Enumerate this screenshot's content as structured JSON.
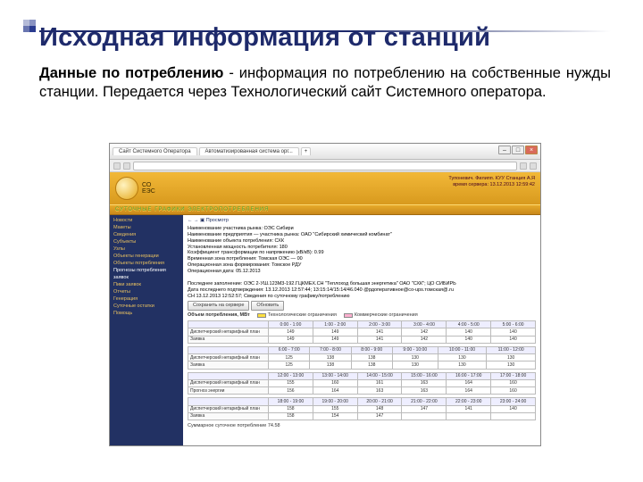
{
  "title": "Исходная информация от станций",
  "desc_bold": "Данные по потреблению",
  "desc_rest": " - информация по потреблению на собственные нужды станции. Передается через Технологический сайт Системного оператора.",
  "browser": {
    "tab1": "Сайт Системного Оператора",
    "tab2": "Автоматизированная система орг...",
    "plus": "+"
  },
  "banner": {
    "org1": "СО",
    "org2": "ЕЭС",
    "right1": "Тупоневич. Филипп. КУУ Станция А.Я",
    "right2": "время сервера: 13.12.2013 12:59:42",
    "sub": "СУТОЧНЫЕ  ГРАФИКИ  ЭЛЕКТРОПОТРЕБЛЕНИЯ"
  },
  "sidebar": {
    "items": [
      "Новости",
      "Макеты",
      "Сведения",
      "Субъекты",
      "Узлы",
      "Объекты генерации",
      "Объекты потребления",
      "Прогнозы потребления заявок",
      "Пики заявок",
      "Отчеты",
      "Генерация",
      "Суточные остатки",
      "Помощь"
    ],
    "active_index": 7
  },
  "main": {
    "crumb": "  ←  →  ▣ Просмотр",
    "info_lines": [
      "Наименование участника рынка: ОЭС Сибири",
      "Наименование предприятия — участника рынка: ОАО \"Сибирский химический комбинат\"",
      "Наименование объекта потребления: СХК",
      "Установленная мощность потребителя: 180",
      "Коэффициент трансформации по напряжению (кВ/кВ): 0.99",
      "Временная зона потребления: Томская ОЭС — 00",
      "Операционная зона формирования: Томское РДУ",
      "Операционная дата: 05.12.2013",
      "",
      "Последнее заполнение: ОЭС 2-УШ.123М3-192.ГЦКМЕХ.СН \"Теплоход большая энергетика\" ОАО \"СХК\"; ЦО СИБИРЬ",
      "Дата последнего подтверждения: 13.12.2013 12:57:44; 13:15:14/15:14/46.040 @рдоперативное@со-ups.томская@.ru",
      "СН 13.12.2013 12:52:57; Сведения по суточному графику/потреблению"
    ],
    "buttons": [
      "Сохранить на сервере",
      "Обновить"
    ],
    "legend_title": "Объем потребления, МВт",
    "legend1": "Технологические ограничения",
    "legend2": "Коммерческие ограничения"
  },
  "chart_data": [
    {
      "type": "table",
      "columns": [
        "0:00 - 1:00",
        "1:00 - 2:00",
        "2:00 - 3:00",
        "3:00 - 4:00",
        "4:00 - 5:00",
        "5:00 - 6:00"
      ],
      "rows": [
        {
          "label": "Диспетчерский нетарифный план",
          "values": [
            149,
            149,
            141,
            142,
            140,
            140
          ]
        },
        {
          "label": "Заявка",
          "values": [
            149,
            149,
            141,
            142,
            140,
            140
          ]
        }
      ]
    },
    {
      "type": "table",
      "columns": [
        "6:00 - 7:00",
        "7:00 - 8:00",
        "8:00 - 9:00",
        "9:00 - 10:00",
        "10:00 - 11:00",
        "11:00 - 12:00"
      ],
      "rows": [
        {
          "label": "Диспетчерский нетарифный план",
          "values": [
            125,
            138,
            138,
            130,
            130,
            130
          ]
        },
        {
          "label": "Заявка",
          "values": [
            125,
            138,
            138,
            130,
            130,
            130
          ]
        }
      ]
    },
    {
      "type": "table",
      "columns": [
        "12:00 - 13:00",
        "13:00 - 14:00",
        "14:00 - 15:00",
        "15:00 - 16:00",
        "16:00 - 17:00",
        "17:00 - 18:00"
      ],
      "rows": [
        {
          "label": "Диспетчерский нетарифный план",
          "values": [
            155,
            160,
            161,
            163,
            164,
            160
          ]
        },
        {
          "label": "Прогноз энергии",
          "values": [
            156,
            164,
            163,
            163,
            164,
            160
          ]
        }
      ]
    },
    {
      "type": "table",
      "columns": [
        "18:00 - 19:00",
        "19:00 - 20:00",
        "20:00 - 21:00",
        "21:00 - 22:00",
        "22:00 - 23:00",
        "23:00 - 24:00"
      ],
      "rows": [
        {
          "label": "Диспетчерский нетарифный план",
          "values": [
            158,
            155,
            148,
            147,
            141,
            140
          ]
        },
        {
          "label": "Заявка",
          "values": [
            158,
            154,
            147,
            "",
            "",
            ""
          ]
        }
      ]
    }
  ],
  "footer_note": "Суммарное суточное потребление    74.58"
}
